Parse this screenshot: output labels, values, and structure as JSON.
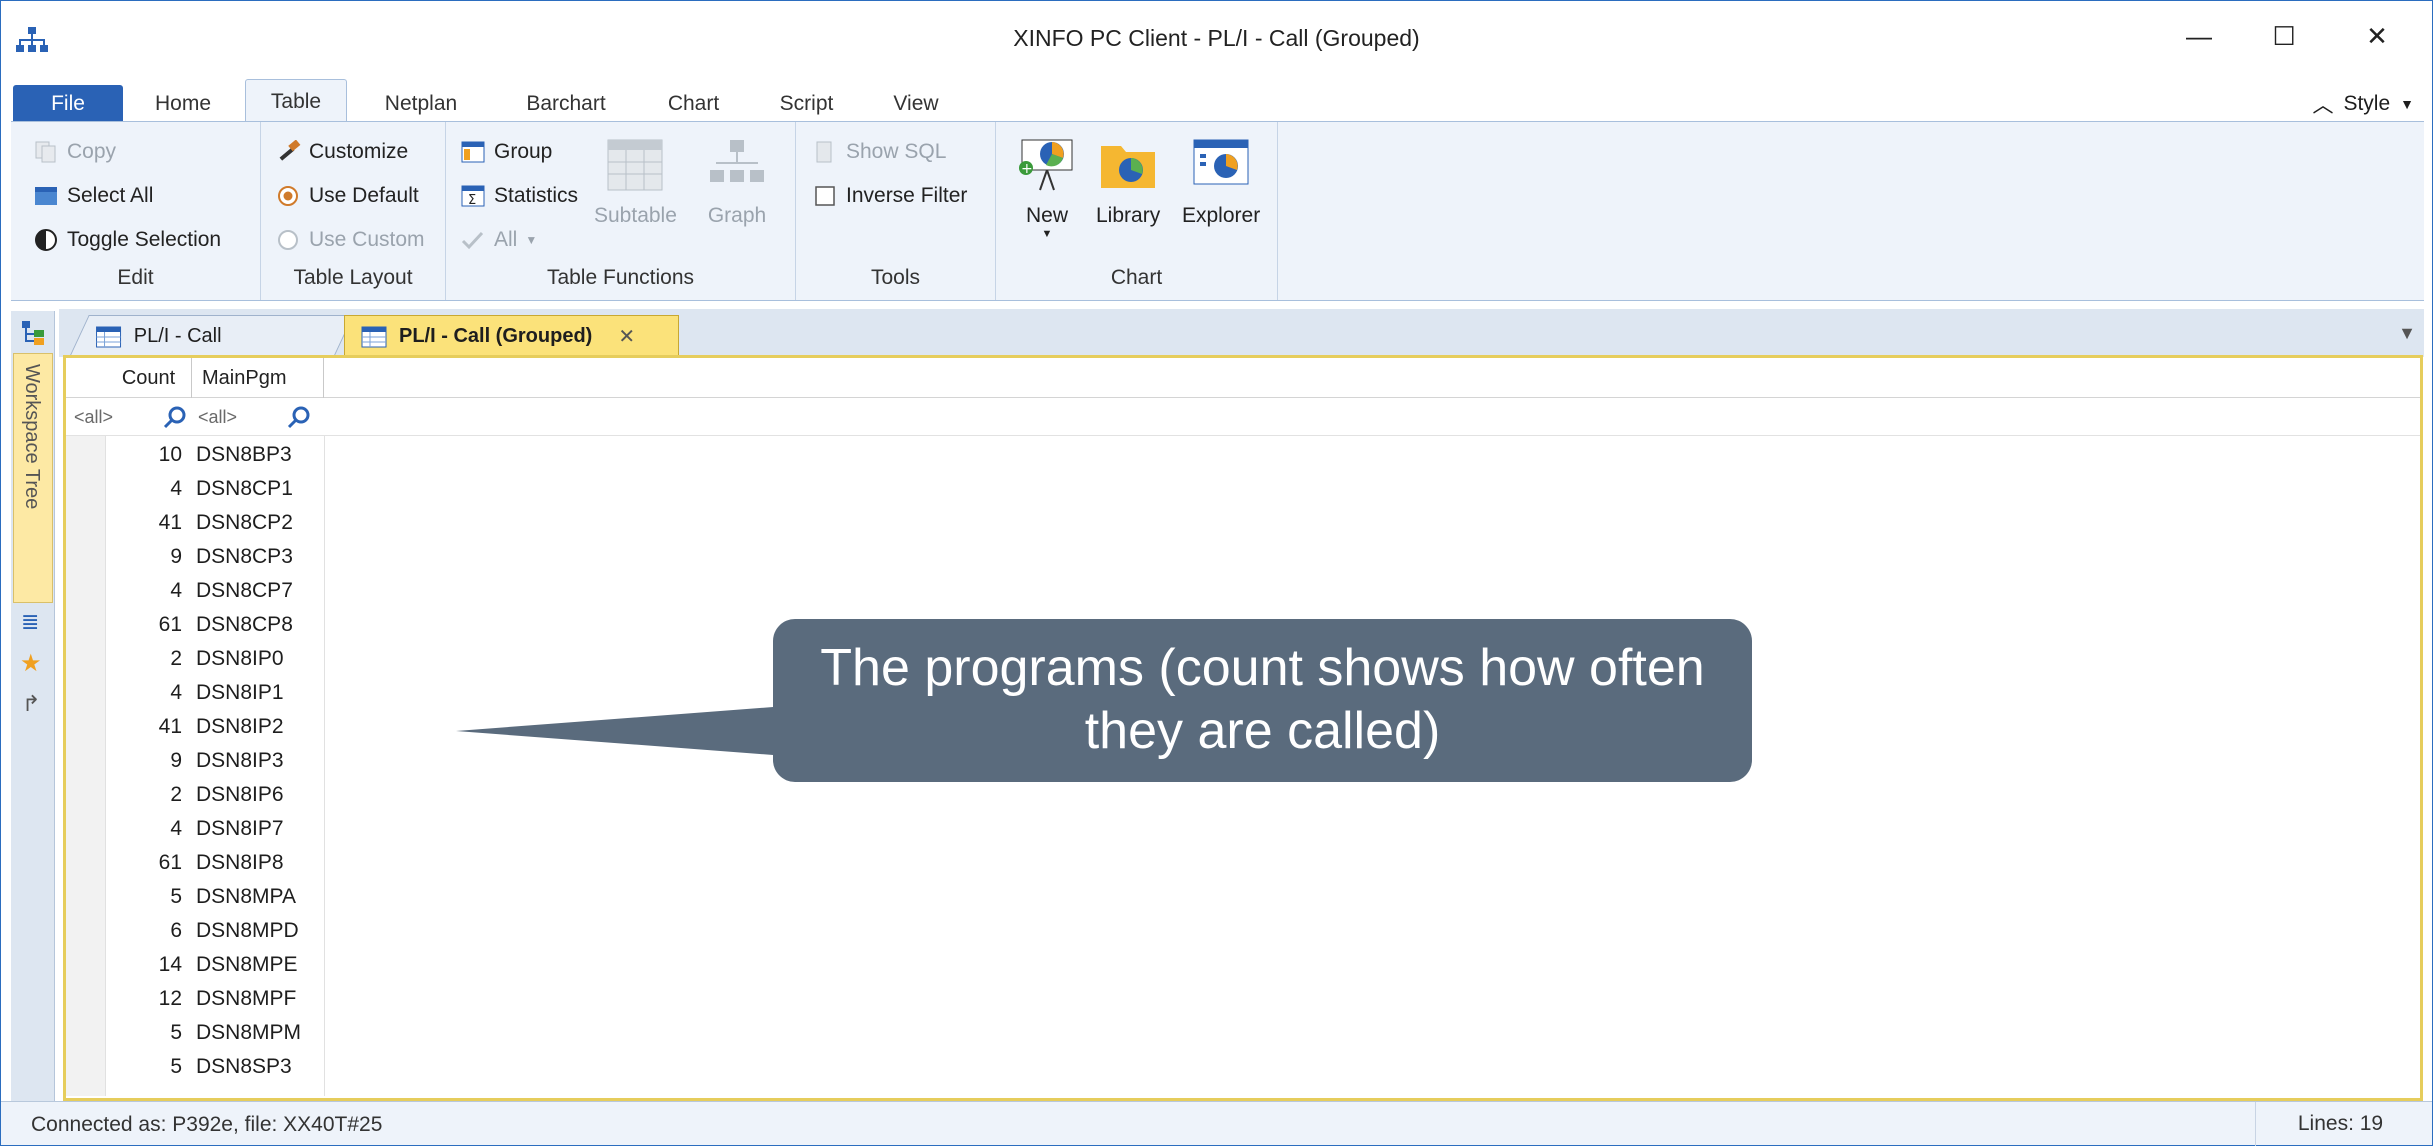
{
  "window": {
    "title": "XINFO PC Client - PL/I - Call (Grouped)",
    "minimize_glyph": "—",
    "maximize_glyph": "☐",
    "close_glyph": "✕"
  },
  "ribbon_tabs": [
    "File",
    "Home",
    "Table",
    "Netplan",
    "Barchart",
    "Chart",
    "Script",
    "View"
  ],
  "active_ribbon_tab": "Table",
  "style_menu": "Style",
  "ribbon": {
    "edit": {
      "title": "Edit",
      "copy": "Copy",
      "select_all": "Select All",
      "toggle_selection": "Toggle Selection"
    },
    "table_layout": {
      "title": "Table Layout",
      "customize": "Customize",
      "use_default": "Use Default",
      "use_custom": "Use Custom"
    },
    "table_functions": {
      "title": "Table Functions",
      "group": "Group",
      "statistics": "Statistics",
      "all": "All",
      "subtable": "Subtable",
      "graph": "Graph"
    },
    "tools": {
      "title": "Tools",
      "show_sql": "Show SQL",
      "inverse_filter": "Inverse Filter"
    },
    "chart": {
      "title": "Chart",
      "new": "New",
      "library": "Library",
      "explorer": "Explorer"
    }
  },
  "sidebar": {
    "workspace_tree": "Workspace Tree"
  },
  "document_tabs": [
    {
      "label": "PL/I - Call",
      "active": false
    },
    {
      "label": "PL/I - Call (Grouped)",
      "active": true
    }
  ],
  "grid": {
    "columns": [
      "Count",
      "MainPgm"
    ],
    "filters": [
      "<all>",
      "<all>"
    ],
    "rows": [
      {
        "count": "10",
        "pgm": "DSN8BP3"
      },
      {
        "count": "4",
        "pgm": "DSN8CP1"
      },
      {
        "count": "41",
        "pgm": "DSN8CP2"
      },
      {
        "count": "9",
        "pgm": "DSN8CP3"
      },
      {
        "count": "4",
        "pgm": "DSN8CP7"
      },
      {
        "count": "61",
        "pgm": "DSN8CP8"
      },
      {
        "count": "2",
        "pgm": "DSN8IP0"
      },
      {
        "count": "4",
        "pgm": "DSN8IP1"
      },
      {
        "count": "41",
        "pgm": "DSN8IP2"
      },
      {
        "count": "9",
        "pgm": "DSN8IP3"
      },
      {
        "count": "2",
        "pgm": "DSN8IP6"
      },
      {
        "count": "4",
        "pgm": "DSN8IP7"
      },
      {
        "count": "61",
        "pgm": "DSN8IP8"
      },
      {
        "count": "5",
        "pgm": "DSN8MPA"
      },
      {
        "count": "6",
        "pgm": "DSN8MPD"
      },
      {
        "count": "14",
        "pgm": "DSN8MPE"
      },
      {
        "count": "12",
        "pgm": "DSN8MPF"
      },
      {
        "count": "5",
        "pgm": "DSN8MPM"
      },
      {
        "count": "5",
        "pgm": "DSN8SP3"
      }
    ]
  },
  "callout": {
    "text_line1": "The programs (count shows how often",
    "text_line2": "they are called)"
  },
  "status": {
    "left": "Connected as: P392e, file: XX40T#25",
    "right": "Lines: 19"
  },
  "colors": {
    "accent": "#2a62b5",
    "active_tab": "#fbe27a",
    "callout": "#5a6b7d",
    "ribbon_bg": "#eef3fa"
  }
}
